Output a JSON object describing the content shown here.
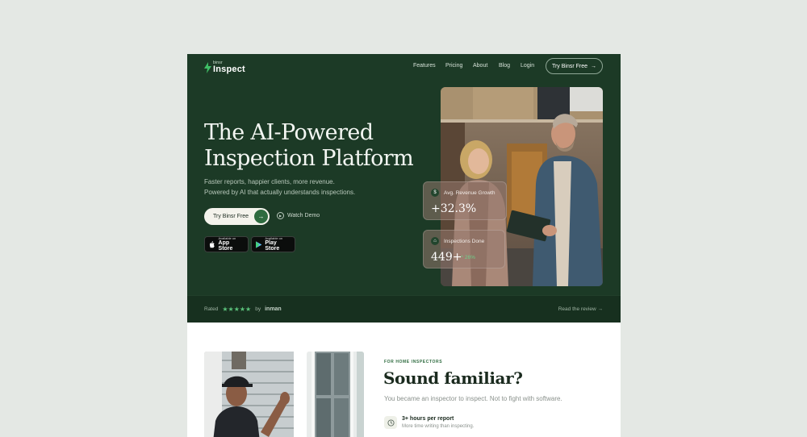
{
  "brand": {
    "small": "binsr",
    "name": "Inspect"
  },
  "nav": {
    "items": [
      "Features",
      "Pricing",
      "About",
      "Blog",
      "Login"
    ],
    "cta": "Try Binsr Free",
    "cta_icon": "arrow-right-icon"
  },
  "hero": {
    "title_line1": "The AI-Powered",
    "title_line2": "Inspection Platform",
    "subtitle_line1": "Faster reports, happier clients, more revenue.",
    "subtitle_line2": "Powered by AI that actually understands inspections.",
    "primary_cta": "Try Binsr Free",
    "secondary_cta": "Watch Demo",
    "stores": [
      {
        "small": "Available on",
        "big": "App Store",
        "icon": "apple-icon"
      },
      {
        "small": "Available on",
        "big": "Play Store",
        "icon": "play-store-icon"
      }
    ]
  },
  "stats": [
    {
      "label": "Avg. Revenue Growth",
      "value": "+32.3%",
      "icon": "dollar-icon"
    },
    {
      "label": "Inspections Done",
      "value": "449+",
      "delta": "^ 26%",
      "icon": "home-icon"
    }
  ],
  "rating": {
    "prefix": "Rated",
    "stars": "★★★★★",
    "by": "by",
    "source": "inman",
    "link": "Read the review →"
  },
  "section": {
    "eyebrow": "FOR HOME INSPECTORS",
    "title": "Sound familiar?",
    "lead": "You became an inspector to inspect. Not to fight with software.",
    "features": [
      {
        "title": "3+ hours per report",
        "desc": "More time writing than inspecting.",
        "icon": "clock-icon"
      }
    ]
  },
  "colors": {
    "hero_bg": "#1c3a26",
    "accent": "#2e6b3f",
    "rating_bar": "#17301f",
    "page_bg": "#e4e8e4"
  }
}
